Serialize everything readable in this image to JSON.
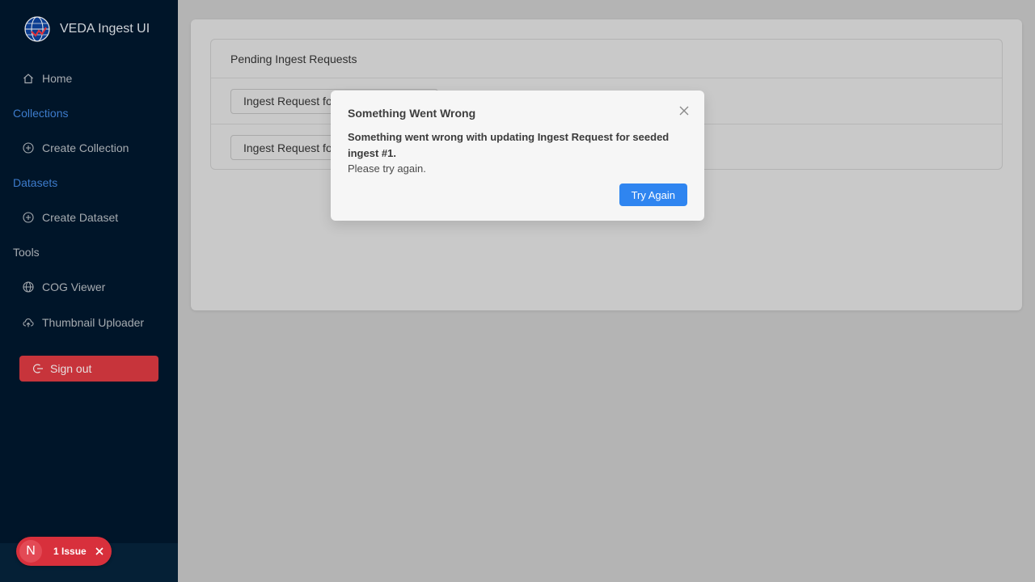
{
  "sidebar": {
    "app_title": "VEDA Ingest UI",
    "items": {
      "home": "Home",
      "collections_group": "Collections",
      "create_collection": "Create Collection",
      "datasets_group": "Datasets",
      "create_dataset": "Create Dataset",
      "tools_group": "Tools",
      "cog_viewer": "COG Viewer",
      "thumbnail_uploader": "Thumbnail Uploader"
    },
    "sign_out": "Sign out"
  },
  "main": {
    "list_title": "Pending Ingest Requests",
    "requests": [
      "Ingest Request for seeded ingest #1",
      "Ingest Request for seeded ingest #2"
    ]
  },
  "modal": {
    "title": "Something Went Wrong",
    "message": "Something went wrong with updating Ingest Request for seeded ingest #1.",
    "sub": "Please try again.",
    "button": "Try Again"
  },
  "issue_badge": {
    "avatar_letter": "N",
    "label": "1 Issue"
  },
  "colors": {
    "sidebar_bg": "#001529",
    "accent_blue": "#3d7ccc",
    "primary_button": "#2f85f0",
    "danger": "#c7343b"
  }
}
